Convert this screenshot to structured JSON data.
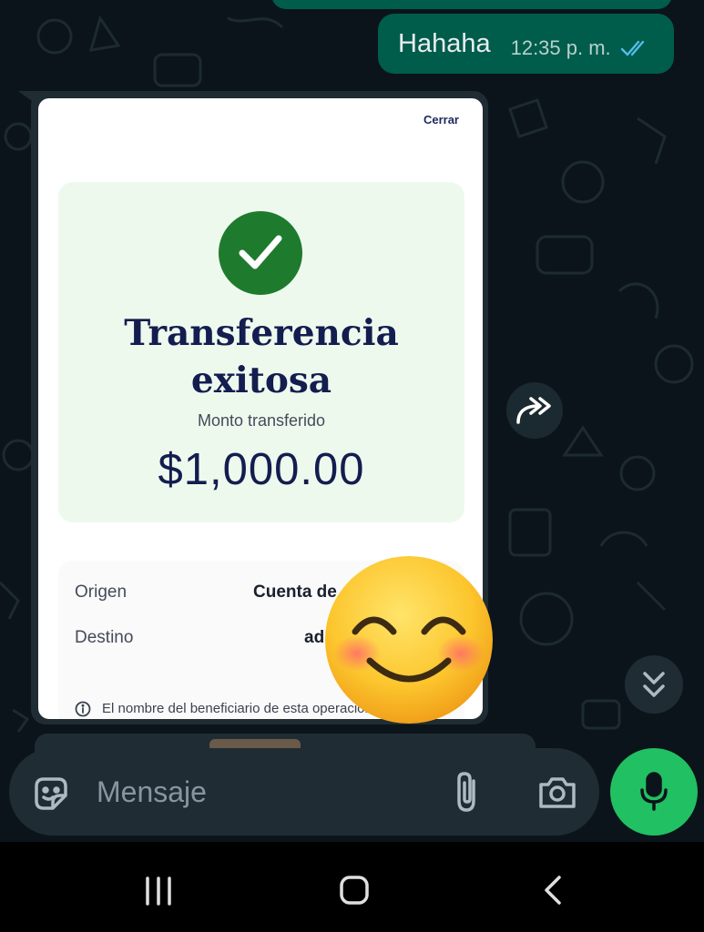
{
  "chat": {
    "sent_message": {
      "text": "Hahaha",
      "time": "12:35 p. m.",
      "status_icon": "double-check-read-icon"
    },
    "image_message": {
      "receipt": {
        "close_label": "Cerrar",
        "status_icon": "check-circle-icon",
        "title": "Transferencia exitosa",
        "amount_label": "Monto transferido",
        "amount": "$1,000.00",
        "origin_label": "Origen",
        "origin_value": "Cuenta de",
        "destination_label": "Destino",
        "destination_value": "ad",
        "note": "El nombre del beneficiario de esta operación..."
      },
      "overlay_emoji": "smiling-face-with-smiling-eyes"
    },
    "forward_icon": "forward-icon",
    "scroll_down_icon": "double-chevron-down-icon"
  },
  "composer": {
    "placeholder": "Mensaje",
    "sticker_icon": "sticker-icon",
    "attach_icon": "paperclip-icon",
    "camera_icon": "camera-icon",
    "mic_icon": "mic-icon"
  },
  "navbar": {
    "recent_icon": "recent-apps-icon",
    "home_icon": "home-icon",
    "back_icon": "back-icon"
  },
  "colors": {
    "background": "#0b141a",
    "sent_bubble": "#005c4b",
    "received_bubble": "#202c33",
    "accent_green": "#21c063",
    "receipt_navy": "#131d4f",
    "check_green": "#1e7b2d",
    "read_ticks": "#53bdeb"
  }
}
